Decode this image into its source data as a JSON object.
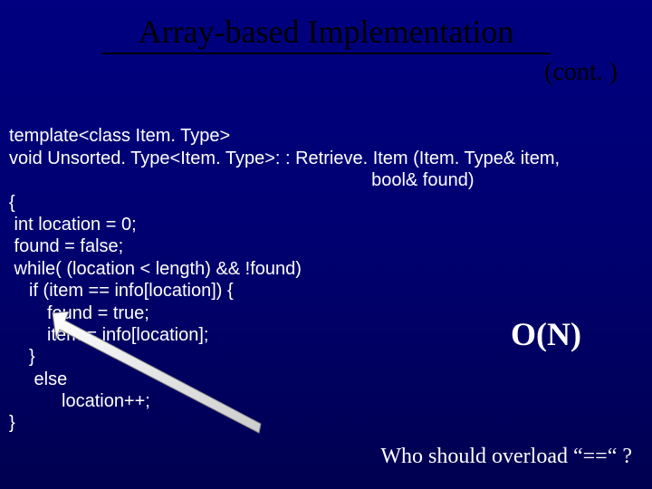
{
  "title": "Array-based Implementation",
  "subtitle": "(cont. )",
  "code": {
    "l1": "template<class Item. Type>",
    "l2": "void Unsorted. Type<Item. Type>: : Retrieve. Item (Item. Type& item,",
    "l3": "                                                                        bool& found)",
    "l4": "{",
    "l5": " int location = 0;",
    "l6": " found = false;",
    "l7": " while( (location < length) && !found)",
    "l8": "if (item == info[location]) {",
    "l9": "found = true;",
    "l10": "item = info[location];",
    "l11": "}",
    "l12": " else",
    "l13": "location++;",
    "l14": "}"
  },
  "annotation": {
    "bigO": "O(N)",
    "question": "Who should  overload “==“  ?"
  }
}
